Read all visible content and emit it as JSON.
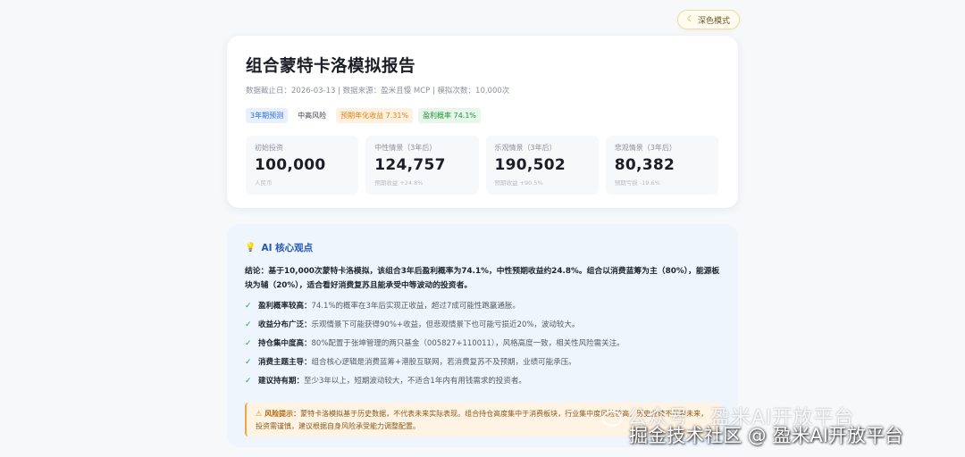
{
  "theme_toggle": {
    "icon": "moon-icon",
    "label": "深色模式"
  },
  "report": {
    "title": "组合蒙特卡洛模拟报告",
    "meta": "数据截止日：2026-03-13 | 数据来源：盈米且慢 MCP | 模拟次数：10,000次",
    "tags": [
      "3年期预测",
      "中高风险",
      "预期年化收益 7.31%",
      "盈利概率 74.1%"
    ]
  },
  "stats": [
    {
      "label": "初始投资",
      "value": "100,000",
      "sub": "人民币"
    },
    {
      "label": "中性情景（3年后）",
      "value": "124,757",
      "sub": "预期收益 +24.8%"
    },
    {
      "label": "乐观情景（3年后）",
      "value": "190,502",
      "sub": "预期收益 +90.5%"
    },
    {
      "label": "悲观情景（3年后）",
      "value": "80,382",
      "sub": "预期亏损 -19.6%"
    }
  ],
  "ai": {
    "title": "AI 核心观点",
    "conclusion": "结论：基于10,000次蒙特卡洛模拟，该组合3年后盈利概率为74.1%，中性预期收益约24.8%。组合以消费蓝筹为主（80%），能源板块为辅（20%），适合看好消费复苏且能承受中等波动的投资者。",
    "points": [
      {
        "head": "盈利概率较高：",
        "body": "74.1%的概率在3年后实现正收益，超过7成可能性跑赢通胀。"
      },
      {
        "head": "收益分布广泛：",
        "body": "乐观情景下可能获得90%+收益，但悲观情景下也可能亏损近20%，波动较大。"
      },
      {
        "head": "持仓集中度高：",
        "body": "80%配置于张坤管理的两只基金（005827+110011），风格高度一致，相关性风险需关注。"
      },
      {
        "head": "消费主题主导：",
        "body": "组合核心逻辑是消费蓝筹+港股互联网，若消费复苏不及预期，业绩可能承压。"
      },
      {
        "head": "建议持有期：",
        "body": "至少3年以上，短期波动较大，不适合1年内有用钱需求的投资者。"
      }
    ],
    "risk_head": "风险提示：",
    "risk_body": "蒙特卡洛模拟基于历史数据，不代表未来实际表现。组合持仓高度集中于消费板块，行业集中度风险较高。历史业绩不代表未来，投资需谨慎，建议根据自身风险承受能力调整配置。"
  },
  "watermark": {
    "line1": "公众号 · 盈米AI开放平台",
    "line2": "掘金技术社区 @ 盈米AI开放平台"
  }
}
